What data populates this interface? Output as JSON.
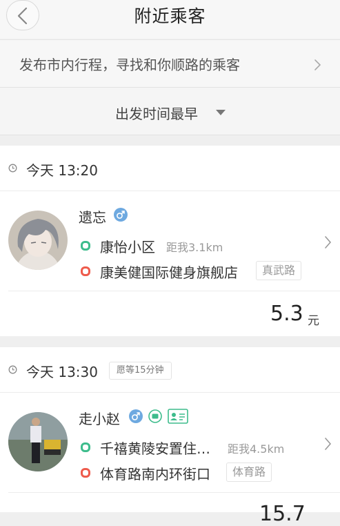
{
  "header": {
    "title": "附近乘客",
    "back_icon": "chevron-left-icon"
  },
  "publish": {
    "text": "发布市内行程，寻找和你顺路的乘客"
  },
  "sort": {
    "label": "出发时间最早"
  },
  "colors": {
    "start_dot": "#3dbc8c",
    "end_dot": "#ee5b4c",
    "male_icon": "#6ea9e0"
  },
  "passengers": [
    {
      "time": "今天 13:20",
      "name": "遗忘",
      "gender_icon": "male-icon",
      "start": "康怡小区",
      "distance": "距我3.1km",
      "end": "康美健国际健身旗舰店",
      "end_road": "真武路",
      "price": "5.3",
      "unit": "元"
    },
    {
      "time": "今天 13:30",
      "wait": "愿等15分钟",
      "name": "走小赵",
      "gender_icon": "male-icon",
      "badges": [
        "car-icon",
        "id-card-icon"
      ],
      "start": "千禧黄陵安置住…",
      "distance": "距我4.5km",
      "end": "体育路南内环街口",
      "end_road": "体育路",
      "price": "15.7"
    }
  ]
}
